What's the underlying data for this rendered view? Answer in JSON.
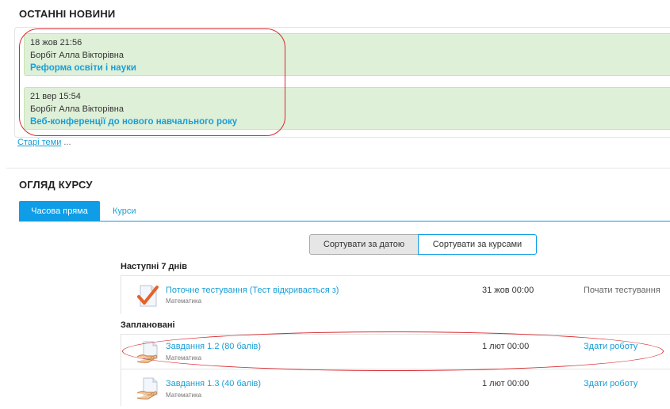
{
  "news": {
    "heading": "ОСТАННІ НОВИНИ",
    "items": [
      {
        "date": "18 жов 21:56",
        "author": "Борбіт Алла Вікторівна",
        "title": "Реформа освіти і науки"
      },
      {
        "date": "21 вер 15:54",
        "author": "Борбіт Алла Вікторівна",
        "title": "Веб-конференції до нового навчального року"
      }
    ],
    "older_link": "Старі теми",
    "older_suffix": " ..."
  },
  "overview": {
    "heading": "ОГЛЯД КУРСУ",
    "tabs": [
      "Часова пряма",
      "Курси"
    ],
    "sort_buttons": [
      "Сортувати за датою",
      "Сортувати за курсами"
    ],
    "sections": [
      {
        "label": "Наступні 7 днів",
        "items": [
          {
            "title": "Поточне тестування (Тест відкривається з)",
            "course": "Математика",
            "date": "31 жов 00:00",
            "action": "Почати тестування",
            "icon": "quiz-check-icon"
          }
        ]
      },
      {
        "label": "Заплановані",
        "items": [
          {
            "title": "Завдання 1.2 (80 балів)",
            "course": "Математика",
            "date": "1 лют 00:00",
            "action": "Здати роботу",
            "icon": "assignment-hand-icon"
          },
          {
            "title": "Завдання 1.3 (40 балів)",
            "course": "Математика",
            "date": "1 лют 00:00",
            "action": "Здати роботу",
            "icon": "assignment-hand-icon"
          }
        ]
      }
    ]
  },
  "colors": {
    "accent": "#0e9de6",
    "link": "#1a9ed6",
    "news_bg": "#dff0d8",
    "annotation": "#d9282f"
  }
}
